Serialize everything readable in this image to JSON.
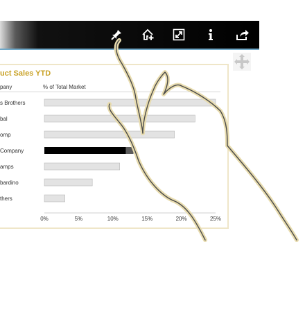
{
  "toolbar": {
    "icons": [
      "pin-icon",
      "home-add-icon",
      "expand-icon",
      "info-icon",
      "share-icon"
    ]
  },
  "panel": {
    "title": "uct Sales YTD",
    "col_company": "pany",
    "col_market": "% of Total Market"
  },
  "chart_data": {
    "type": "bar",
    "orientation": "horizontal",
    "categories": [
      "s Brothers",
      "bal",
      "omp",
      "Company",
      "amps",
      "bardino",
      "thers"
    ],
    "values": [
      25,
      22,
      19,
      13,
      11,
      7,
      3
    ],
    "highlight_index": 3,
    "xlim": [
      0,
      25
    ],
    "xticks": [
      "0%",
      "5%",
      "10%",
      "15%",
      "20%",
      "25%"
    ],
    "colors": {
      "bar": "#e3e3e3",
      "bar_border": "#b8b8b8",
      "highlight": "#000000",
      "highlight_tail": "#5c5c5c",
      "title": "#c9a227"
    }
  }
}
